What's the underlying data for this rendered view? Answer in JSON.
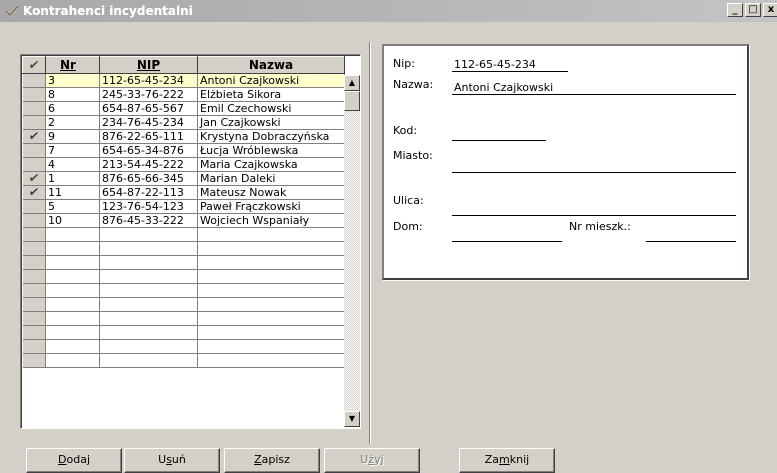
{
  "window": {
    "title": "Kontrahenci incydentalni",
    "minimize": "_",
    "maximize": "□",
    "close": "x"
  },
  "grid": {
    "columns": {
      "check": "✔",
      "nr": "Nr",
      "nip": "NIP",
      "nazwa": "Nazwa"
    },
    "rows": [
      {
        "checked": false,
        "nr": "3",
        "nip": "112-65-45-234",
        "nazwa": "Antoni Czajkowski",
        "selected": true
      },
      {
        "checked": false,
        "nr": "8",
        "nip": "245-33-76-222",
        "nazwa": "Elżbieta Sikora"
      },
      {
        "checked": false,
        "nr": "6",
        "nip": "654-87-65-567",
        "nazwa": "Emil Czechowski"
      },
      {
        "checked": false,
        "nr": "2",
        "nip": "234-76-45-234",
        "nazwa": "Jan Czajkowski"
      },
      {
        "checked": true,
        "nr": "9",
        "nip": "876-22-65-111",
        "nazwa": "Krystyna Dobraczyńska"
      },
      {
        "checked": false,
        "nr": "7",
        "nip": "654-65-34-876",
        "nazwa": "Łucja Wróblewska"
      },
      {
        "checked": false,
        "nr": "4",
        "nip": "213-54-45-222",
        "nazwa": "Maria Czajkowska"
      },
      {
        "checked": true,
        "nr": "1",
        "nip": "876-65-66-345",
        "nazwa": "Marian Daleki"
      },
      {
        "checked": true,
        "nr": "11",
        "nip": "654-87-22-113",
        "nazwa": "Mateusz Nowak"
      },
      {
        "checked": false,
        "nr": "5",
        "nip": "123-76-54-123",
        "nazwa": "Paweł Frączkowski"
      },
      {
        "checked": false,
        "nr": "10",
        "nip": "876-45-33-222",
        "nazwa": "Wojciech Wspaniały"
      }
    ],
    "empty_rows": 10
  },
  "form": {
    "nip_label": "Nip:",
    "nip_value": "112-65-45-234",
    "nazwa_label": "Nazwa:",
    "nazwa_value": "Antoni Czajkowski",
    "kod_label": "Kod:",
    "kod_value": "",
    "miasto_label": "Miasto:",
    "miasto_value": "",
    "ulica_label": "Ulica:",
    "ulica_value": "",
    "dom_label": "Dom:",
    "dom_value": "",
    "nr_mieszk_label": "Nr mieszk.:",
    "nr_mieszk_value": ""
  },
  "buttons": {
    "dodaj": {
      "before": "",
      "mnemonic": "D",
      "after": "odaj"
    },
    "usun": {
      "before": "U",
      "mnemonic": "s",
      "after": "uń"
    },
    "zapisz": {
      "before": "",
      "mnemonic": "Z",
      "after": "apisz"
    },
    "uzyj": {
      "before": "U",
      "mnemonic": "ż",
      "after": "yj"
    },
    "zamknij": {
      "before": "Za",
      "mnemonic": "m",
      "after": "knij"
    }
  },
  "colors": {
    "face": "#d4d0c8",
    "selected_row": "#ffffcc"
  }
}
